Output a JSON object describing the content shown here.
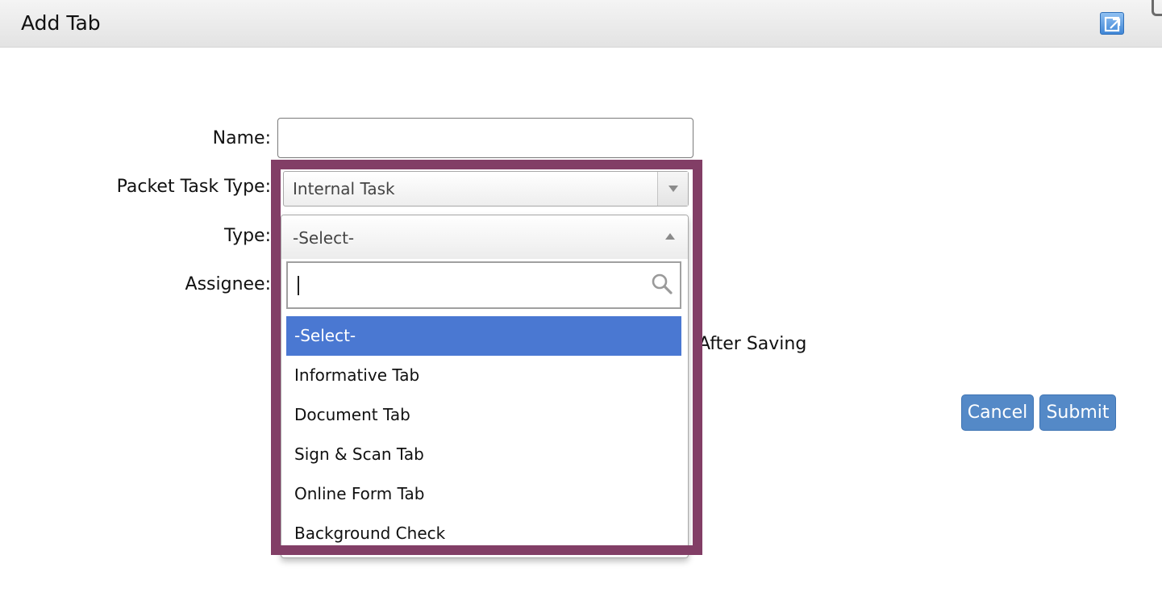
{
  "dialog": {
    "title": "Add Tab"
  },
  "icons": {
    "popout": "popout-icon",
    "search": "search-icon",
    "dropdown_closed": "chevron-down-icon",
    "dropdown_open": "chevron-up-icon"
  },
  "form": {
    "name_label": "Name:",
    "name_value": "",
    "packet_task_type_label": "Packet Task Type:",
    "packet_task_type_value": "Internal Task",
    "type_label": "Type:",
    "type_value": "-Select-",
    "type_search_value": "",
    "assignee_label": "Assignee:",
    "after_saving_text": "After Saving"
  },
  "type_options": [
    {
      "label": "-Select-",
      "selected": true
    },
    {
      "label": "Informative Tab",
      "selected": false
    },
    {
      "label": "Document Tab",
      "selected": false
    },
    {
      "label": "Sign & Scan Tab",
      "selected": false
    },
    {
      "label": "Online Form Tab",
      "selected": false
    },
    {
      "label": "Background Check",
      "selected": false
    }
  ],
  "buttons": {
    "cancel": "Cancel",
    "submit": "Submit"
  },
  "colors": {
    "highlight_frame": "#823e66",
    "button_bg": "#5489c7",
    "selected_option_bg": "#4a78d2"
  }
}
